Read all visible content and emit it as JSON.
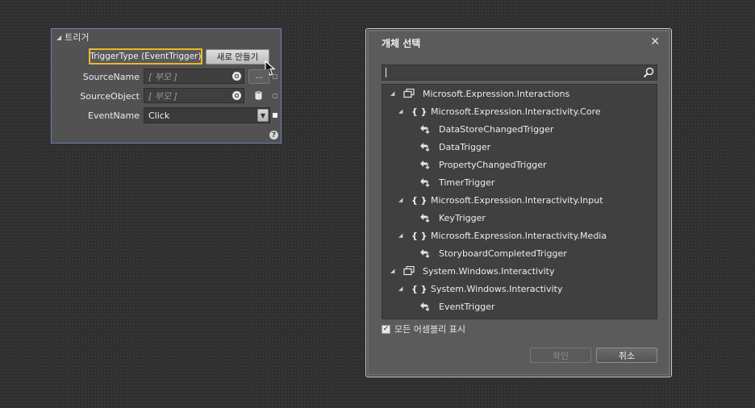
{
  "trigger_panel": {
    "header": "트리거",
    "trigger_type": "TriggerType (EventTrigger)",
    "new_button": "새로 만들기",
    "source_name": {
      "label": "SourceName",
      "value": "[ 부모 ]"
    },
    "source_object": {
      "label": "SourceObject",
      "value": "[ 부모 ]"
    },
    "event_name": {
      "label": "EventName",
      "value": "Click"
    },
    "dots_button": "..."
  },
  "dialog": {
    "title": "개체 선택",
    "close": "✕",
    "search_value": "",
    "tree": [
      {
        "kind": "assembly",
        "label": "Microsoft.Expression.Interactions"
      },
      {
        "kind": "namespace",
        "label": "Microsoft.Expression.Interactivity.Core"
      },
      {
        "kind": "trigger",
        "label": "DataStoreChangedTrigger"
      },
      {
        "kind": "trigger",
        "label": "DataTrigger"
      },
      {
        "kind": "trigger",
        "label": "PropertyChangedTrigger"
      },
      {
        "kind": "trigger",
        "label": "TimerTrigger"
      },
      {
        "kind": "namespace",
        "label": "Microsoft.Expression.Interactivity.Input"
      },
      {
        "kind": "trigger",
        "label": "KeyTrigger"
      },
      {
        "kind": "namespace",
        "label": "Microsoft.Expression.Interactivity.Media"
      },
      {
        "kind": "trigger",
        "label": "StoryboardCompletedTrigger"
      },
      {
        "kind": "assembly",
        "label": "System.Windows.Interactivity"
      },
      {
        "kind": "namespace",
        "label": "System.Windows.Interactivity"
      },
      {
        "kind": "trigger",
        "label": "EventTrigger"
      }
    ],
    "show_all_assemblies": {
      "label": "모든 어셈블리 표시",
      "checked": true
    },
    "ok_button": "확인",
    "cancel_button": "취소"
  }
}
